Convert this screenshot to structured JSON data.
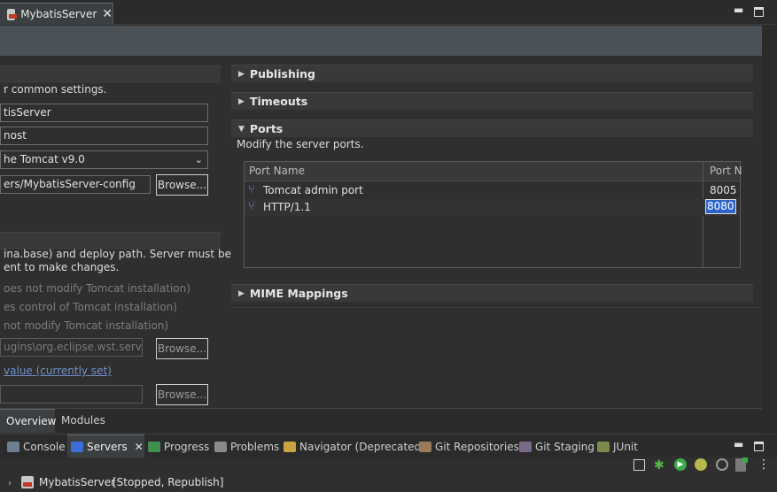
{
  "editor_tab": {
    "title": "MybatisServer"
  },
  "general": {
    "description": "r common settings.",
    "server_name": "tisServer",
    "host_name": "nost",
    "runtime": "he Tomcat v9.0",
    "config_path": "ers/MybatisServer-config",
    "browse_label": "Browse..."
  },
  "locations": {
    "desc_line1": "ina.base) and deploy path. Server must be",
    "desc_line2": "ent to make changes.",
    "option1": "oes not modify Tomcat installation)",
    "option2": "es control of Tomcat installation)",
    "option3": "not modify Tomcat installation)",
    "server_path": "ugins\\org.eclipse.wst.server.co",
    "set_default_link": "value (currently set)",
    "browse1": "Browse...",
    "browse2": "Browse..."
  },
  "sections": {
    "publishing": "Publishing",
    "timeouts": "Timeouts",
    "ports": "Ports",
    "ports_desc": "Modify the server ports.",
    "mime": "MIME Mappings"
  },
  "ports_table": {
    "col_name": "Port Name",
    "col_number": "Port N",
    "rows": [
      {
        "name": "Tomcat admin port",
        "number": "8005"
      },
      {
        "name": "HTTP/1.1",
        "number": "8080"
      }
    ]
  },
  "form_tabs": {
    "overview": "Overview",
    "modules": "Modules"
  },
  "views": {
    "console": "Console",
    "servers": "Servers",
    "progress": "Progress",
    "problems": "Problems",
    "navigator": "Navigator (Deprecated)",
    "git_repos": "Git Repositories",
    "git_staging": "Git Staging",
    "junit": "JUnit"
  },
  "server_entry": {
    "name": "MybatisServer",
    "status": "[Stopped, Republish]"
  },
  "colors": {
    "accent_blue": "#2f65ca",
    "link": "#6f8fc8",
    "header_band": "#4a5157"
  }
}
